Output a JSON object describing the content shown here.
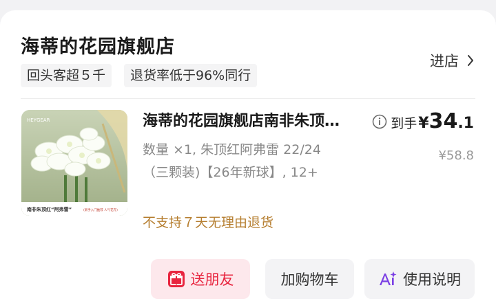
{
  "shop": {
    "name": "海蒂的花园旗舰店",
    "badges": [
      "回头客超５千",
      "退货率低于96%同行"
    ],
    "enter_label": "进店"
  },
  "product": {
    "title": "海蒂的花园旗舰店南非朱顶红阿弗雷",
    "spec": "数量 ×1, 朱顶红阿弗雷 22/24（三颗装)【26年新球】, 12+",
    "price_label": "到手",
    "currency": "¥",
    "price_int": "34",
    "price_dec": ".1",
    "original_price": "¥58.8",
    "return_notice": "不支持７天无理由退货",
    "image_caption": "南非朱顶红“阿弗雷”",
    "image_caption_note": "(新手入门推荐 人气花卉)",
    "image_brand": "HEYGEAR"
  },
  "actions": {
    "gift_label": "送朋友",
    "cart_label": "加购物车",
    "guide_label": "使用说明"
  },
  "colors": {
    "warning": "#b57d2e",
    "gift_accent": "#e8253f",
    "gift_bg": "#fde8ec",
    "ai_icon": "#7b3fe4"
  }
}
